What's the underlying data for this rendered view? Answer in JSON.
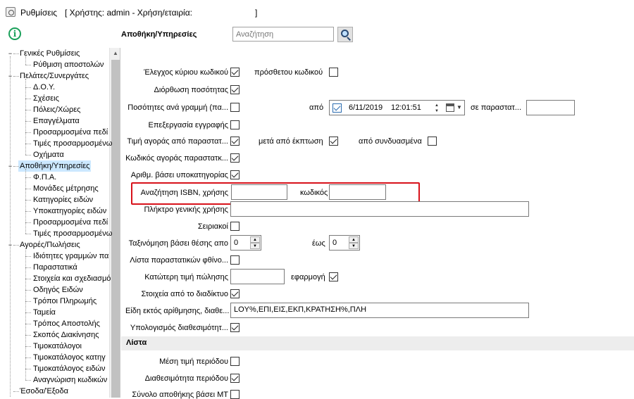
{
  "window": {
    "title": "Ρυθμίσεις",
    "user_info": "[ Χρήστης: admin - Χρήση/εταιρία:",
    "user_info_close": "]"
  },
  "header": {
    "section": "Αποθήκη/Υπηρεσίες",
    "search_placeholder": "Αναζήτηση"
  },
  "tree": {
    "items": [
      {
        "label": "Γενικές Ρυθμίσεις",
        "level": 0,
        "expander": "−"
      },
      {
        "label": "Ρύθμιση αποστολών",
        "level": 1
      },
      {
        "label": "Πελάτες/Συνεργάτες",
        "level": 0,
        "expander": "−"
      },
      {
        "label": "Δ.Ο.Υ.",
        "level": 1
      },
      {
        "label": "Σχέσεις",
        "level": 1
      },
      {
        "label": "Πόλεις/Χώρες",
        "level": 1
      },
      {
        "label": "Επαγγέλματα",
        "level": 1
      },
      {
        "label": "Προσαρμοσμένα πεδί",
        "level": 1
      },
      {
        "label": "Τιμές προσαρμοσμένω",
        "level": 1
      },
      {
        "label": "Οχήματα",
        "level": 1
      },
      {
        "label": "Αποθήκη/Υπηρεσίες",
        "level": 0,
        "expander": "−",
        "selected": true
      },
      {
        "label": "Φ.Π.Α.",
        "level": 1
      },
      {
        "label": "Μονάδες μέτρησης",
        "level": 1
      },
      {
        "label": "Κατηγορίες ειδών",
        "level": 1
      },
      {
        "label": "Υποκατηγορίες ειδών",
        "level": 1
      },
      {
        "label": "Προσαρμοσμένα πεδί",
        "level": 1
      },
      {
        "label": "Τιμές προσαρμοσμένω",
        "level": 1
      },
      {
        "label": "Αγορές/Πωλήσεις",
        "level": 0,
        "expander": "−"
      },
      {
        "label": "Ιδιότητες γραμμών πα",
        "level": 1
      },
      {
        "label": "Παραστατικά",
        "level": 1
      },
      {
        "label": "Στοιχεία και σχεδιασμό",
        "level": 1
      },
      {
        "label": "Οδηγός Ειδών",
        "level": 1
      },
      {
        "label": "Τρόποι Πληρωμής",
        "level": 1
      },
      {
        "label": "Ταμεία",
        "level": 1
      },
      {
        "label": "Τρόπος Αποστολής",
        "level": 1
      },
      {
        "label": "Σκοπός Διακίνησης",
        "level": 1
      },
      {
        "label": "Τιμοκατάλογοι",
        "level": 1
      },
      {
        "label": "Τιμοκατάλογος κατηγ",
        "level": 1
      },
      {
        "label": "Τιμοκατάλογος ειδών",
        "level": 1
      },
      {
        "label": "Αναγνώριση κωδικών",
        "level": 1
      },
      {
        "label": "Έσοδα/Έξοδα",
        "level": 0
      }
    ]
  },
  "form": {
    "main_code_check": "Έλεγχος κύριου κωδικού",
    "extra_code": "πρόσθετου κωδικού",
    "quantity_fix": "Διόρθωση ποσότητας",
    "qty_per_line": "Ποσότητες ανά γραμμή (πα...",
    "from_label": "από",
    "date": "6/11/2019",
    "time": "12:01:51",
    "in_docs": "σε παραστατ...",
    "edit_record": "Επεξεργασία εγγραφής",
    "buy_price_from_doc": "Τιμή αγοράς από παραστατ...",
    "after_discount": "μετά από έκπτωση",
    "from_combined": "από συνδυασμένα",
    "buy_code_doc": "Κωδικός αγοράς παραστατκ...",
    "numbering_subcat": "Αριθμ. βάσει υποκατηγορίας",
    "isbn_search": "Αναζήτηση ISBN, χρήσης",
    "code_label": "κωδικός",
    "general_key": "Πλήκτρο γενικής χρήσης",
    "serials": "Σειριακοί",
    "sort_position": "Ταξινόμηση βάσει θέσης απο",
    "sort_from_value": "0",
    "to_label": "έως",
    "sort_to_value": "0",
    "doc_list_desc": "Λίστα παραστατικών φθίνο...",
    "min_sale_price": "Κατώτερη τιμή πώλησης",
    "apply_label": "εφαρμογή",
    "web_data": "Στοιχεία από το διαδίκτυο",
    "excluded_items": "Είδη εκτός αρίθμησης, διαθε...",
    "excluded_items_value": "LOY%,ΕΠΙ,ΕΙΣ,ΕΚΠ,ΚΡΑΤΗΣΗ%,ΠΛΗ",
    "availability_calc": "Υπολογισμός διαθεσιμότητ...",
    "list_section": "Λίστα",
    "avg_price_period": "Μέση τιμή περιόδου",
    "availability_period": "Διαθεσιμότητα περιόδου",
    "warehouse_total": "Σύνολο αποθήκης βάσει ΜΤ"
  }
}
